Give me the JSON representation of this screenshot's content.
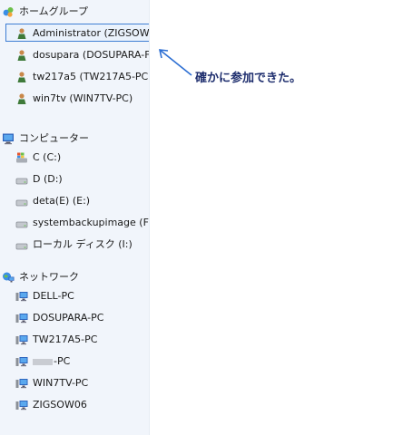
{
  "tree": {
    "homegroup": {
      "label": "ホームグループ",
      "items": [
        "Administrator (ZIGSOW",
        "dosupara (DOSUPARA-F",
        "tw217a5 (TW217A5-PC)",
        "win7tv (WIN7TV-PC)"
      ]
    },
    "computer": {
      "label": "コンピューター",
      "items": [
        "C (C:)",
        "D (D:)",
        "deta(E) (E:)",
        "systembackupimage (F",
        "ローカル ディスク (I:)"
      ]
    },
    "network": {
      "label": "ネットワーク",
      "items": [
        "DELL-PC",
        "DOSUPARA-PC",
        "TW217A5-PC",
        "-PC",
        "WIN7TV-PC",
        "ZIGSOW06"
      ]
    }
  },
  "annotation": {
    "text": "確かに参加できた。",
    "color": "#1e2e6e"
  },
  "selection": {
    "item": "Administrator (ZIGSOW",
    "border_color": "#3f7ed4"
  },
  "icons": {
    "homegroup": "homegroup-icon",
    "user": "user-icon",
    "computer": "computer-icon",
    "system_drive": "windows-drive-icon",
    "drive": "drive-icon",
    "network": "network-icon",
    "pc": "pc-icon"
  }
}
